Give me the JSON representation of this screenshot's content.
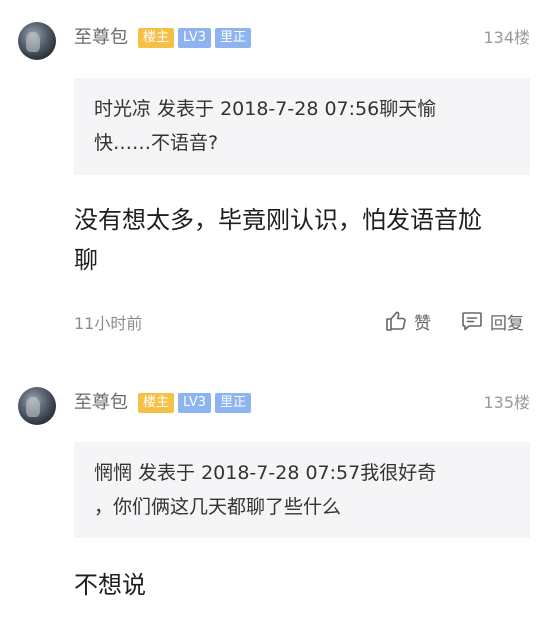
{
  "posts": [
    {
      "user": {
        "name": "至尊包",
        "badges": {
          "owner": "楼主",
          "level": "LV3",
          "title": "里正"
        }
      },
      "floor": "134楼",
      "quote": {
        "line1": "时光凉 发表于 2018-7-28 07:56聊天愉",
        "line2": "快……不语音?"
      },
      "content": {
        "line1": "没有想太多，毕竟刚认识，怕发语音尬",
        "line2": "聊"
      },
      "time": "11小时前",
      "actions": {
        "like": "赞",
        "reply": "回复"
      }
    },
    {
      "user": {
        "name": "至尊包",
        "badges": {
          "owner": "楼主",
          "level": "LV3",
          "title": "里正"
        }
      },
      "floor": "135楼",
      "quote": {
        "line1": "惘惘 发表于 2018-7-28 07:57我很好奇",
        "line2": "，你们俩这几天都聊了些什么"
      },
      "content": {
        "line1": "不想说"
      }
    }
  ],
  "colors": {
    "owner_badge": "#f5c046",
    "level_badge": "#8db4f0",
    "quote_bg": "#f5f5f7"
  }
}
